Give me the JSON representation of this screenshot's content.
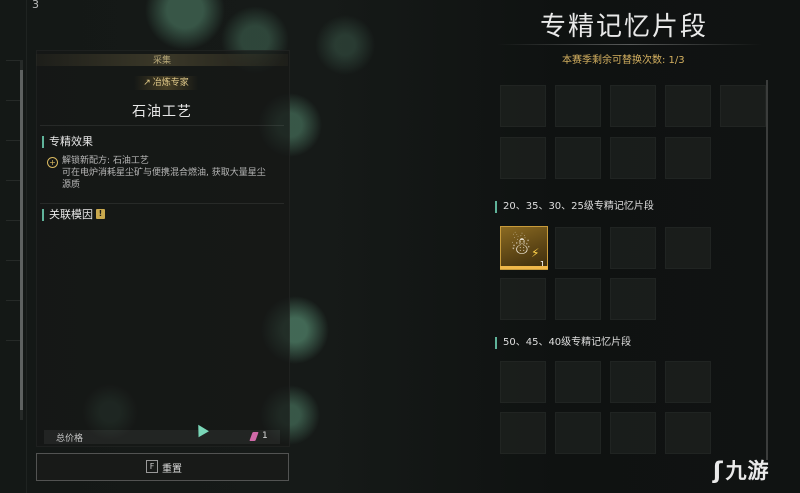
{
  "top_number": "3",
  "left_panel": {
    "category": "采集",
    "specialist": "冶炼专家",
    "skill_title": "石油工艺",
    "effect_section_title": "专精效果",
    "effect_lines": [
      "解锁新配方: 石油工艺",
      "可在电炉消耗星尘矿与便携混合燃油, 获取大量星尘",
      "源质"
    ],
    "related_genes_title": "关联模因",
    "info_icon": "!",
    "total_price_label": "总价格",
    "total_price_value": "1",
    "reset_key": "F",
    "reset_label": "重置"
  },
  "right_panel": {
    "title": "专精记忆片段",
    "replace_count": "本赛季剩余可替换次数: 1/3",
    "group1_title": "20、35、30、25级专精记忆片段",
    "group2_title": "50、45、40级专精记忆片段",
    "fragment_count": "1"
  },
  "logo": {
    "mark": "ʃ",
    "text": "九游"
  },
  "colors": {
    "accent_green": "#5fb39a",
    "gold": "#d4b060",
    "fragment_orange": "#f0b84a"
  }
}
